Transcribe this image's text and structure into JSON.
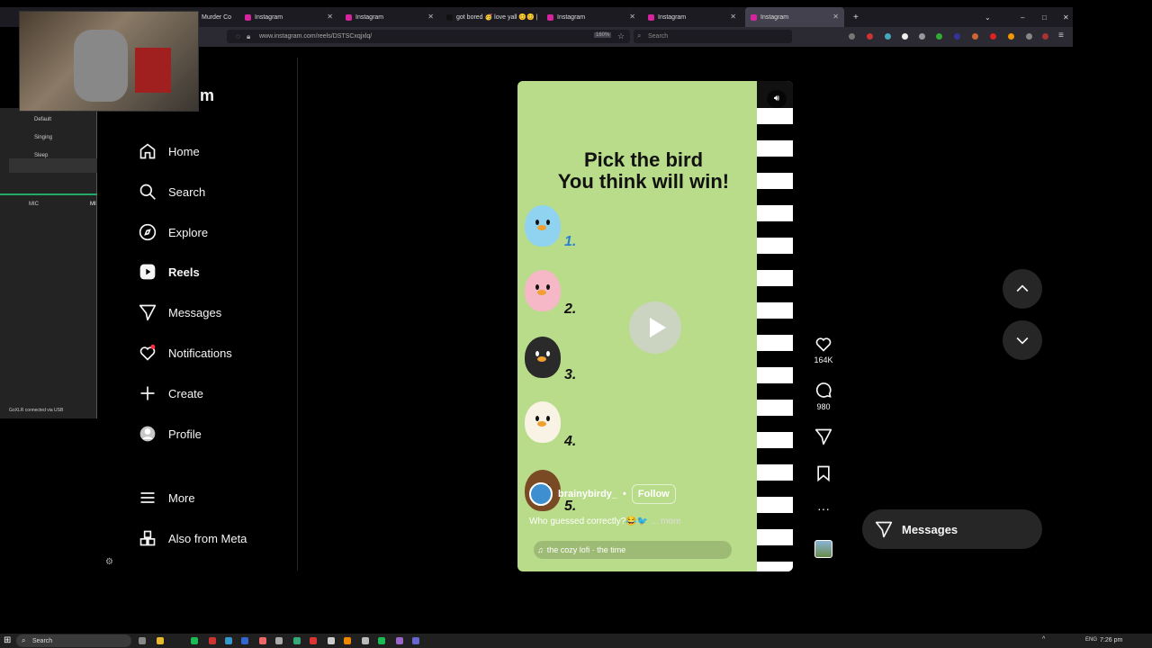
{
  "browser": {
    "tabs": [
      {
        "label": "Murder Co",
        "active": false
      },
      {
        "label": "Instagram",
        "active": false
      },
      {
        "label": "Instagram",
        "active": false
      },
      {
        "label": "got bored 🥳 love yall 😊😊 | ",
        "active": false
      },
      {
        "label": "Instagram",
        "active": false
      },
      {
        "label": "Instagram",
        "active": false
      },
      {
        "label": "Instagram",
        "active": true
      }
    ],
    "url": "www.instagram.com/reels/DSTSCxqjxlq/",
    "zoom": "160%",
    "search_placeholder": "Search",
    "new_tab": "+"
  },
  "sidebar": {
    "logo_fragment": "m",
    "items": [
      {
        "label": "Home",
        "icon": "home-icon"
      },
      {
        "label": "Search",
        "icon": "search-icon"
      },
      {
        "label": "Explore",
        "icon": "compass-icon"
      },
      {
        "label": "Reels",
        "icon": "reels-icon",
        "active": true
      },
      {
        "label": "Messages",
        "icon": "send-icon"
      },
      {
        "label": "Notifications",
        "icon": "heart-icon"
      },
      {
        "label": "Create",
        "icon": "plus-icon"
      },
      {
        "label": "Profile",
        "icon": "avatar-icon"
      }
    ],
    "more": "More",
    "meta": "Also from Meta"
  },
  "reel": {
    "title_line1": "Pick the bird",
    "title_line2": "You think will win!",
    "birds": [
      {
        "num": "1.",
        "color": "#8fd3f0"
      },
      {
        "num": "2.",
        "color": "#f6b8c6"
      },
      {
        "num": "3.",
        "color": "#2a2a2a"
      },
      {
        "num": "4.",
        "color": "#f8f3e4"
      },
      {
        "num": "5.",
        "color": "#7a4a25"
      }
    ],
    "author": "brainybirdy_",
    "dot": "•",
    "follow": "Follow",
    "caption": "Who guessed correctly?😂🐦",
    "caption_more": "... more",
    "music": "the cozy lofi · the time"
  },
  "actions": {
    "likes": "164K",
    "comments": "980"
  },
  "messages_button": "Messages",
  "overlay": {
    "panel_items": [
      "Default",
      "Singing",
      "Sleep"
    ],
    "mic_label": "MIC",
    "mi_label": "MI",
    "status": "GoXLR connected via USB"
  },
  "taskbar": {
    "search": "Search",
    "lang": "ENG",
    "time": "7:26 pm"
  },
  "colors": {
    "bg": "#000000",
    "accent_like": "#ff3040",
    "reel_bg": "#b9dc8a"
  }
}
